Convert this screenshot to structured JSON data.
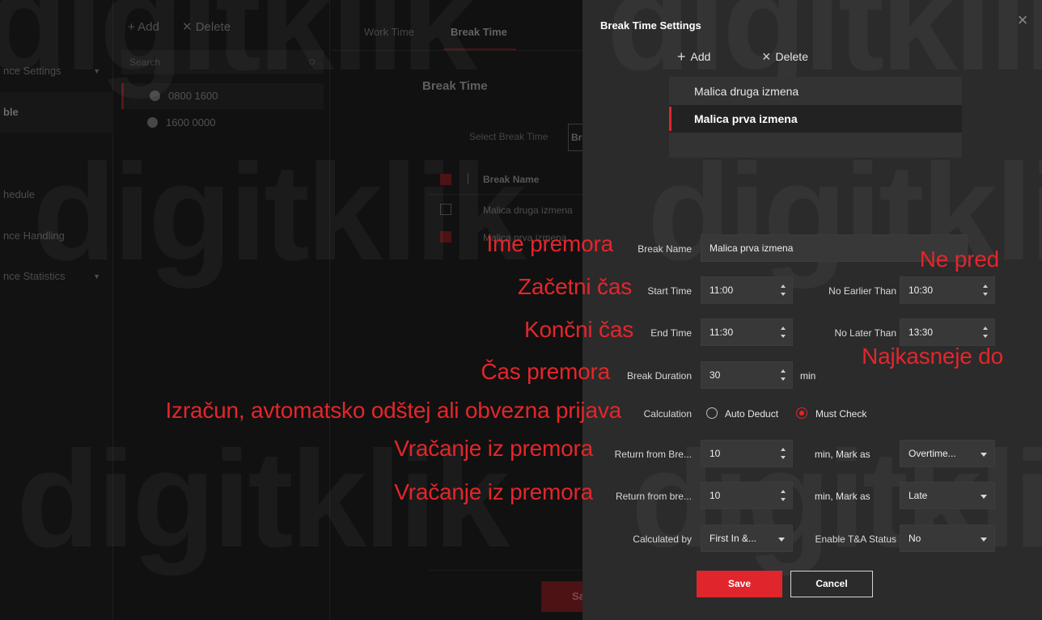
{
  "background": {
    "sidebar": [
      {
        "label": "nce Settings",
        "caret": "▼"
      },
      {
        "label": "ble"
      },
      {
        "label": "hedule"
      },
      {
        "label": "nce Handling"
      },
      {
        "label": "nce Statistics",
        "caret": "▼"
      }
    ],
    "toolbar": {
      "add": "+ Add",
      "delete": "✕ Delete"
    },
    "search_placeholder": "Search",
    "schedules": [
      "0800  1600",
      "1600  0000"
    ],
    "tabs": [
      "Work Time",
      "Break Time"
    ],
    "section_title": "Break Time",
    "select_label": "Select Break Time",
    "select_value": "Bre",
    "table_header": "Break Name",
    "rows": [
      "Malica druga izmena",
      "Malica prva izmena"
    ],
    "save": "Save"
  },
  "dialog": {
    "title": "Break Time Settings",
    "close": "×",
    "add": "Add",
    "delete": "Delete",
    "list": [
      "Malica druga izmena",
      "Malica prva izmena"
    ],
    "form": {
      "break_name": {
        "label": "Break Name",
        "value": "Malica prva izmena"
      },
      "start_time": {
        "label": "Start Time",
        "value": "11:00"
      },
      "no_earlier_than": {
        "label": "No Earlier Than",
        "value": "10:30"
      },
      "end_time": {
        "label": "End Time",
        "value": "11:30"
      },
      "no_later_than": {
        "label": "No Later Than",
        "value": "13:30"
      },
      "break_duration": {
        "label": "Break Duration",
        "value": "30",
        "unit": "min"
      },
      "calculation": {
        "label": "Calculation",
        "options": [
          "Auto Deduct",
          "Must Check"
        ],
        "selected": "Must Check"
      },
      "return_early": {
        "label": "Return from Bre...",
        "value": "10",
        "unit": "min, Mark as",
        "mark": "Overtime..."
      },
      "return_late": {
        "label": "Return from bre...",
        "value": "10",
        "unit": "min, Mark as",
        "mark": "Late"
      },
      "calculated_by": {
        "label": "Calculated by",
        "value": "First In &..."
      },
      "enable_ta": {
        "label": "Enable T&A Status",
        "value": "No"
      }
    },
    "save": "Save",
    "cancel": "Cancel"
  },
  "annotations": {
    "break_name": "Ime premora",
    "start_time": "Začetni čas",
    "end_time": "Končni čas",
    "duration": "Čas premora",
    "calculation": "Izračun, avtomatsko odštej ali obvezna prijava",
    "return_early": "Vračanje iz premora",
    "return_late": "Vračanje iz premora",
    "no_earlier": "Ne pred",
    "no_later": "Najkasneje do"
  },
  "watermark": "digitklik",
  "colors": {
    "accent": "#e0262c",
    "annotation": "#e3262b",
    "dialog_bg": "#2b2b2b",
    "app_bg": "#111111"
  }
}
